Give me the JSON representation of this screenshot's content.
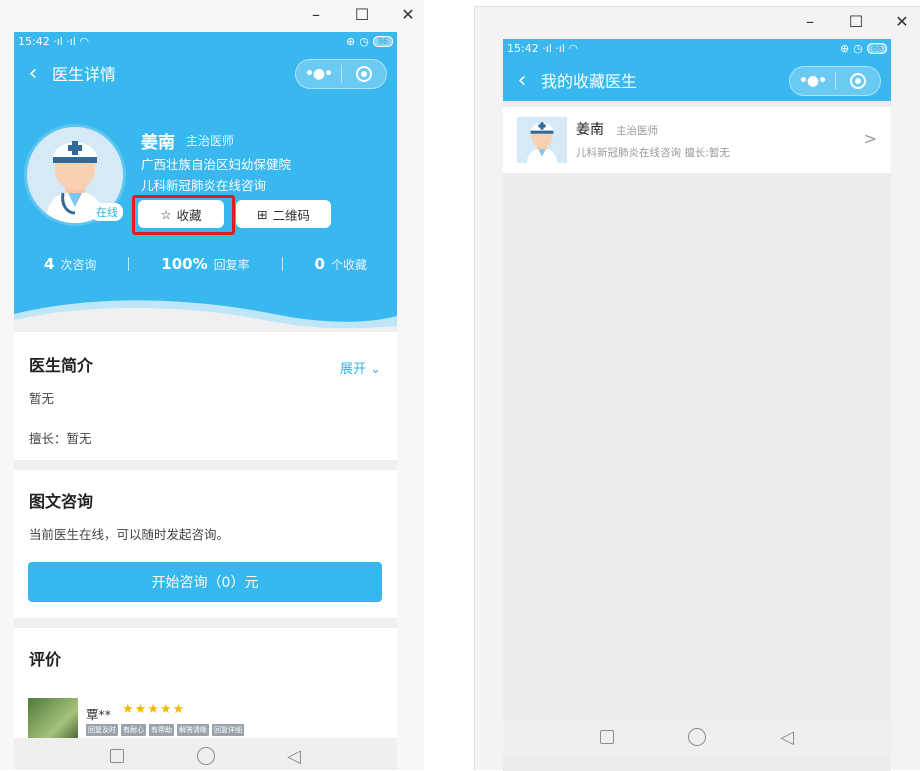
{
  "window_controls": {
    "minimize": "–",
    "maximize": "☐",
    "close": "✕"
  },
  "status": {
    "time": "15:42",
    "signal": "·ıl ·ıl",
    "battery": "86"
  },
  "left": {
    "nav_title": "医生详情",
    "doctor": {
      "name": "姜南",
      "rank": "主治医师",
      "hospital": "广西壮族自治区妇幼保健院",
      "department": "儿科新冠肺炎在线咨询",
      "online_label": "在线"
    },
    "buttons": {
      "favorite": "收藏",
      "qrcode": "二维码"
    },
    "stats": [
      {
        "value": "4",
        "label": "次咨询"
      },
      {
        "value": "100%",
        "label": "回复率"
      },
      {
        "value": "0",
        "label": "个收藏"
      }
    ],
    "intro": {
      "title": "医生简介",
      "expand_label": "展开",
      "body": "暂无",
      "specialty": "擅长：暂无"
    },
    "consult": {
      "title": "图文咨询",
      "desc": "当前医生在线，可以随时发起咨询。",
      "start_button": "开始咨询（0）元"
    },
    "reviews": {
      "title": "评价",
      "reviewer": "覃**",
      "stars": "★★★★★",
      "tags": [
        "回复及时",
        "有耐心",
        "有帮助",
        "解答清晰",
        "回复详细"
      ]
    }
  },
  "right": {
    "nav_title": "我的收藏医生",
    "item": {
      "name": "姜南",
      "rank": "主治医师",
      "desc": "儿科新冠肺炎在线咨询 擅长:暂无",
      "arrow": ">"
    }
  },
  "colors": {
    "primary": "#38b8ee",
    "highlight": "#e01c1c",
    "star": "#f5b800"
  }
}
